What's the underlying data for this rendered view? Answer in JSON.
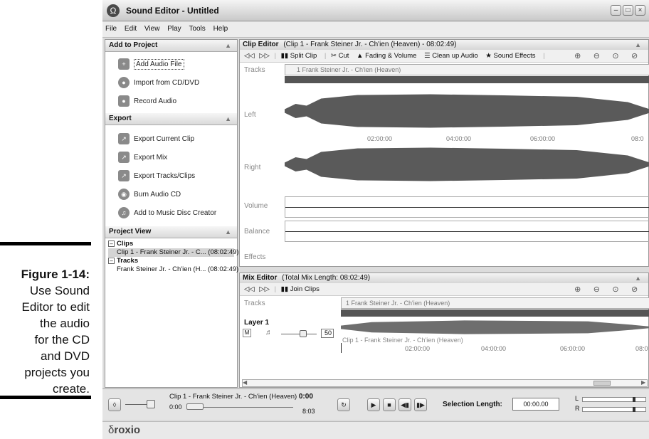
{
  "caption": {
    "figure": "Figure 1-14:",
    "lines": [
      "Use Sound",
      "Editor to edit",
      "the audio",
      "for the CD",
      "and DVD",
      "projects you",
      "create."
    ]
  },
  "window": {
    "title": "Sound Editor - Untitled"
  },
  "menu": [
    "File",
    "Edit",
    "View",
    "Play",
    "Tools",
    "Help"
  ],
  "add_to_project": {
    "title": "Add to Project",
    "items": [
      "Add Audio File",
      "Import from CD/DVD",
      "Record Audio"
    ]
  },
  "export": {
    "title": "Export",
    "items": [
      "Export Current Clip",
      "Export Mix",
      "Export Tracks/Clips",
      "Burn Audio CD",
      "Add to Music Disc Creator"
    ]
  },
  "project_view": {
    "title": "Project View",
    "clips_label": "Clips",
    "clip_item": "Clip 1 - Frank Steiner Jr. - C... (08:02:49)",
    "tracks_label": "Tracks",
    "track_item": "Frank Steiner Jr. - Ch'ien (H... (08:02:49)"
  },
  "clip_editor": {
    "title": "Clip Editor",
    "subtitle": "(Clip 1 - Frank Steiner Jr. - Ch'ien (Heaven) - 08:02:49)",
    "toolbar": [
      "Split Clip",
      "Cut",
      "Fading & Volume",
      "Clean up Audio",
      "Sound Effects"
    ],
    "tracks_label": "Tracks",
    "track_name": "1 Frank Steiner Jr. - Ch'ien (Heaven)",
    "rows": [
      "Left",
      "Right",
      "Volume",
      "Balance",
      "Effects"
    ],
    "times": [
      "02:00:00",
      "04:00:00",
      "06:00:00",
      "08:0"
    ]
  },
  "mix_editor": {
    "title": "Mix Editor",
    "subtitle": "(Total Mix Length: 08:02:49)",
    "toolbar": [
      "Join Clips"
    ],
    "tracks_label": "Tracks",
    "track_name": "1 Frank Steiner Jr. - Ch'ien (Heaven)",
    "layer": "Layer 1",
    "layer_value": "50",
    "clip_label": "Clip 1 - Frank Steiner Jr. - Ch'ien (Heaven)",
    "times": [
      "02:00:00",
      "04:00:00",
      "06:00:00",
      "08:0"
    ]
  },
  "transport": {
    "now_playing": "Clip 1 - Frank Steiner Jr. - Ch'ien (Heaven)",
    "position": "0:00",
    "start": "0:00",
    "end": "8:03",
    "selection_label": "Selection Length:",
    "selection_value": "00:00.00",
    "meter_l": "L",
    "meter_r": "R"
  },
  "footer": {
    "brand": "roxio"
  }
}
